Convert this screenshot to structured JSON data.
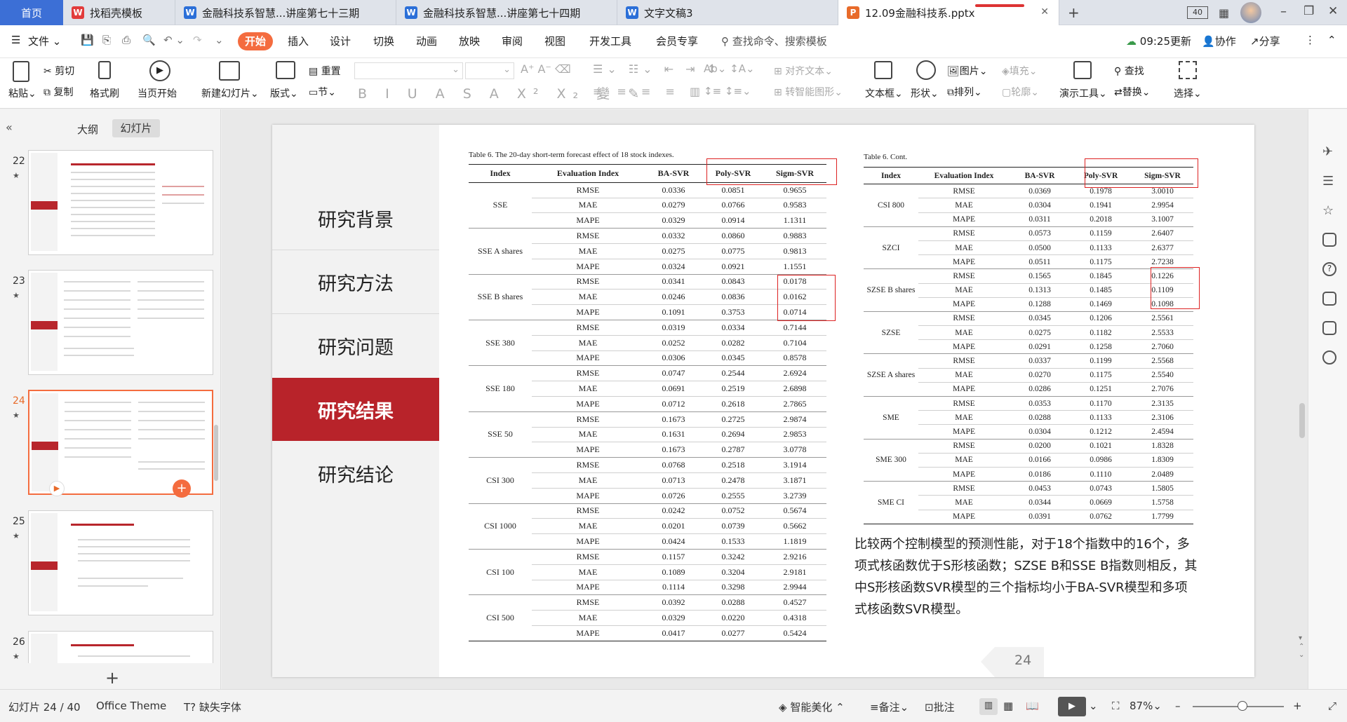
{
  "tabs": [
    {
      "label": "首页",
      "active": true
    },
    {
      "label": "找稻壳模板",
      "icon": "daoke-icon"
    },
    {
      "label": "金融科技系智慧...讲座第七十三期",
      "icon": "wps-writer-icon"
    },
    {
      "label": "金融科技系智慧...讲座第七十四期",
      "icon": "wps-writer-icon"
    },
    {
      "label": "文字文稿3",
      "icon": "wps-writer-icon"
    },
    {
      "label": "12.09金融科技系.pptx",
      "icon": "wps-presentation-icon"
    }
  ],
  "window": {
    "badge": "40"
  },
  "menu": {
    "file": "文件",
    "items": [
      "开始",
      "插入",
      "设计",
      "切换",
      "动画",
      "放映",
      "审阅",
      "视图",
      "开发工具",
      "会员专享"
    ],
    "search": "查找命令、搜索模板",
    "time": "09:25更新",
    "collab": "协作",
    "share": "分享"
  },
  "ribbon": {
    "paste": "粘贴",
    "cut": "剪切",
    "copy": "复制",
    "format_painter": "格式刷",
    "from_start": "当页开始",
    "new_slide": "新建幻灯片",
    "layout": "版式",
    "reset": "重置",
    "section": "节",
    "align_text": "对齐文本",
    "smart_art": "转智能图形",
    "textbox": "文本框",
    "shape": "形状",
    "picture": "图片",
    "fill": "填充",
    "arrange": "排列",
    "outline": "轮廓",
    "presenter": "演示工具",
    "find": "查找",
    "replace": "替换",
    "select": "选择"
  },
  "panel": {
    "outline": "大纲",
    "slides": "幻灯片",
    "thumbs": [
      {
        "num": "22"
      },
      {
        "num": "23"
      },
      {
        "num": "24",
        "active": true
      },
      {
        "num": "25"
      },
      {
        "num": "26"
      }
    ]
  },
  "slide": {
    "nav": [
      "研究背景",
      "研究方法",
      "研究问题",
      "研究结果",
      "研究结论"
    ],
    "active_nav": "研究结果",
    "table1": {
      "caption": "Table 6. The 20-day short-term forecast effect of 18 stock indexes.",
      "headers": [
        "Index",
        "Evaluation Index",
        "BA-SVR",
        "Poly-SVR",
        "Sigm-SVR"
      ],
      "groups": [
        {
          "index": "SSE",
          "rows": [
            [
              "RMSE",
              "0.0336",
              "0.0851",
              "0.9655"
            ],
            [
              "MAE",
              "0.0279",
              "0.0766",
              "0.9583"
            ],
            [
              "MAPE",
              "0.0329",
              "0.0914",
              "1.1311"
            ]
          ]
        },
        {
          "index": "SSE A shares",
          "rows": [
            [
              "RMSE",
              "0.0332",
              "0.0860",
              "0.9883"
            ],
            [
              "MAE",
              "0.0275",
              "0.0775",
              "0.9813"
            ],
            [
              "MAPE",
              "0.0324",
              "0.0921",
              "1.1551"
            ]
          ]
        },
        {
          "index": "SSE B shares",
          "rows": [
            [
              "RMSE",
              "0.0341",
              "0.0843",
              "0.0178"
            ],
            [
              "MAE",
              "0.0246",
              "0.0836",
              "0.0162"
            ],
            [
              "MAPE",
              "0.1091",
              "0.3753",
              "0.0714"
            ]
          ]
        },
        {
          "index": "SSE 380",
          "rows": [
            [
              "RMSE",
              "0.0319",
              "0.0334",
              "0.7144"
            ],
            [
              "MAE",
              "0.0252",
              "0.0282",
              "0.7104"
            ],
            [
              "MAPE",
              "0.0306",
              "0.0345",
              "0.8578"
            ]
          ]
        },
        {
          "index": "SSE 180",
          "rows": [
            [
              "RMSE",
              "0.0747",
              "0.2544",
              "2.6924"
            ],
            [
              "MAE",
              "0.0691",
              "0.2519",
              "2.6898"
            ],
            [
              "MAPE",
              "0.0712",
              "0.2618",
              "2.7865"
            ]
          ]
        },
        {
          "index": "SSE 50",
          "rows": [
            [
              "RMSE",
              "0.1673",
              "0.2725",
              "2.9874"
            ],
            [
              "MAE",
              "0.1631",
              "0.2694",
              "2.9853"
            ],
            [
              "MAPE",
              "0.1673",
              "0.2787",
              "3.0778"
            ]
          ]
        },
        {
          "index": "CSI 300",
          "rows": [
            [
              "RMSE",
              "0.0768",
              "0.2518",
              "3.1914"
            ],
            [
              "MAE",
              "0.0713",
              "0.2478",
              "3.1871"
            ],
            [
              "MAPE",
              "0.0726",
              "0.2555",
              "3.2739"
            ]
          ]
        },
        {
          "index": "CSI 1000",
          "rows": [
            [
              "RMSE",
              "0.0242",
              "0.0752",
              "0.5674"
            ],
            [
              "MAE",
              "0.0201",
              "0.0739",
              "0.5662"
            ],
            [
              "MAPE",
              "0.0424",
              "0.1533",
              "1.1819"
            ]
          ]
        },
        {
          "index": "CSI 100",
          "rows": [
            [
              "RMSE",
              "0.1157",
              "0.3242",
              "2.9216"
            ],
            [
              "MAE",
              "0.1089",
              "0.3204",
              "2.9181"
            ],
            [
              "MAPE",
              "0.1114",
              "0.3298",
              "2.9944"
            ]
          ]
        },
        {
          "index": "CSI 500",
          "rows": [
            [
              "RMSE",
              "0.0392",
              "0.0288",
              "0.4527"
            ],
            [
              "MAE",
              "0.0329",
              "0.0220",
              "0.4318"
            ],
            [
              "MAPE",
              "0.0417",
              "0.0277",
              "0.5424"
            ]
          ]
        }
      ]
    },
    "table2": {
      "caption": "Table 6. Cont.",
      "headers": [
        "Index",
        "Evaluation Index",
        "BA-SVR",
        "Poly-SVR",
        "Sigm-SVR"
      ],
      "groups": [
        {
          "index": "CSI 800",
          "rows": [
            [
              "RMSE",
              "0.0369",
              "0.1978",
              "3.0010"
            ],
            [
              "MAE",
              "0.0304",
              "0.1941",
              "2.9954"
            ],
            [
              "MAPE",
              "0.0311",
              "0.2018",
              "3.1007"
            ]
          ]
        },
        {
          "index": "SZCI",
          "rows": [
            [
              "RMSE",
              "0.0573",
              "0.1159",
              "2.6407"
            ],
            [
              "MAE",
              "0.0500",
              "0.1133",
              "2.6377"
            ],
            [
              "MAPE",
              "0.0511",
              "0.1175",
              "2.7238"
            ]
          ]
        },
        {
          "index": "SZSE B shares",
          "rows": [
            [
              "RMSE",
              "0.1565",
              "0.1845",
              "0.1226"
            ],
            [
              "MAE",
              "0.1313",
              "0.1485",
              "0.1109"
            ],
            [
              "MAPE",
              "0.1288",
              "0.1469",
              "0.1098"
            ]
          ]
        },
        {
          "index": "SZSE",
          "rows": [
            [
              "RMSE",
              "0.0345",
              "0.1206",
              "2.5561"
            ],
            [
              "MAE",
              "0.0275",
              "0.1182",
              "2.5533"
            ],
            [
              "MAPE",
              "0.0291",
              "0.1258",
              "2.7060"
            ]
          ]
        },
        {
          "index": "SZSE A shares",
          "rows": [
            [
              "RMSE",
              "0.0337",
              "0.1199",
              "2.5568"
            ],
            [
              "MAE",
              "0.0270",
              "0.1175",
              "2.5540"
            ],
            [
              "MAPE",
              "0.0286",
              "0.1251",
              "2.7076"
            ]
          ]
        },
        {
          "index": "SME",
          "rows": [
            [
              "RMSE",
              "0.0353",
              "0.1170",
              "2.3135"
            ],
            [
              "MAE",
              "0.0288",
              "0.1133",
              "2.3106"
            ],
            [
              "MAPE",
              "0.0304",
              "0.1212",
              "2.4594"
            ]
          ]
        },
        {
          "index": "SME 300",
          "rows": [
            [
              "RMSE",
              "0.0200",
              "0.1021",
              "1.8328"
            ],
            [
              "MAE",
              "0.0166",
              "0.0986",
              "1.8309"
            ],
            [
              "MAPE",
              "0.0186",
              "0.1110",
              "2.0489"
            ]
          ]
        },
        {
          "index": "SME CI",
          "rows": [
            [
              "RMSE",
              "0.0453",
              "0.0743",
              "1.5805"
            ],
            [
              "MAE",
              "0.0344",
              "0.0669",
              "1.5758"
            ],
            [
              "MAPE",
              "0.0391",
              "0.0762",
              "1.7799"
            ]
          ]
        }
      ]
    },
    "note": "比较两个控制模型的预测性能，对于18个指数中的16个，多项式核函数优于S形核函数；SZSE B和SSE B指数则相反，其中S形核函数SVR模型的三个指标均小于BA-SVR模型和多项式核函数SVR模型。",
    "page_number": "24"
  },
  "status": {
    "slide_info": "幻灯片 24 / 40",
    "theme": "Office Theme",
    "missing_font": "缺失字体",
    "beautify": "智能美化",
    "notes": "备注",
    "comment": "批注",
    "zoom": "87%"
  },
  "colors": {
    "accent": "#b8232a",
    "wps_orange": "#e86b2a",
    "ribbon_tab": "#f46c3f"
  }
}
